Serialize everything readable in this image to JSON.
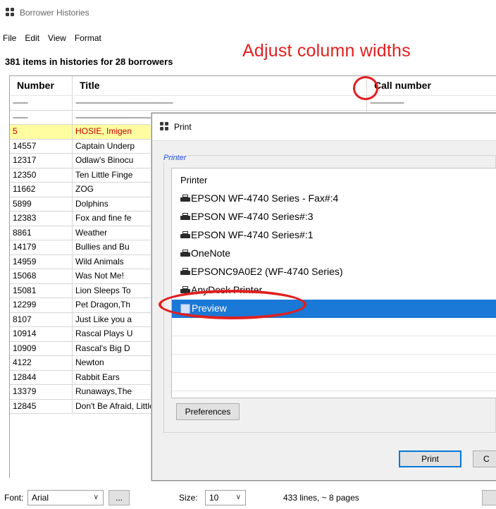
{
  "window": {
    "title": "Borrower Histories"
  },
  "menu": [
    "File",
    "Edit",
    "View",
    "Format"
  ],
  "summary": "381 items in histories for 28 borrowers",
  "annotation": "Adjust column widths",
  "table": {
    "headers": {
      "number": "Number",
      "title": "Title",
      "call": "Call number"
    },
    "rows": [
      {
        "number": "-------",
        "title": "----------------------------------------------",
        "call": "----------------",
        "type": "dash"
      },
      {
        "number": "-------",
        "title": "----------------------------------------------",
        "call": "",
        "type": "dash"
      },
      {
        "number": "5",
        "title": "HOSIE, Imigen",
        "call": "",
        "type": "highlight"
      },
      {
        "number": "14557",
        "title": "Captain Underp",
        "call": ""
      },
      {
        "number": "12317",
        "title": "Odlaw's Binocu",
        "call": ""
      },
      {
        "number": "12350",
        "title": "Ten Little Finge",
        "call": ""
      },
      {
        "number": "11662",
        "title": "ZOG",
        "call": ""
      },
      {
        "number": "5899",
        "title": "Dolphins",
        "call": ""
      },
      {
        "number": "12383",
        "title": "Fox and fine fe",
        "call": ""
      },
      {
        "number": "8861",
        "title": "Weather",
        "call": ""
      },
      {
        "number": "14179",
        "title": "Bullies and Bu",
        "call": ""
      },
      {
        "number": "14959",
        "title": "Wild Animals",
        "call": ""
      },
      {
        "number": "15068",
        "title": "Was Not Me!",
        "call": ""
      },
      {
        "number": "15081",
        "title": "Lion Sleeps To",
        "call": ""
      },
      {
        "number": "12299",
        "title": "Pet Dragon,Th",
        "call": ""
      },
      {
        "number": "8107",
        "title": "Just Like you a",
        "call": ""
      },
      {
        "number": "10914",
        "title": "Rascal Plays U",
        "call": ""
      },
      {
        "number": "10909",
        "title": "Rascal's Big D",
        "call": ""
      },
      {
        "number": "4122",
        "title": "Newton",
        "call": ""
      },
      {
        "number": "12844",
        "title": "Rabbit Ears",
        "call": ""
      },
      {
        "number": "13379",
        "title": "Runaways,The",
        "call": ""
      },
      {
        "number": "12845",
        "title": "Don't Be Afraid, Little One",
        "call": ""
      }
    ]
  },
  "dialog": {
    "title": "Print",
    "group_label": "Printer",
    "list_header": "Printer",
    "printers": [
      {
        "name": "EPSON WF-4740 Series - Fax#:4",
        "icon": "printer-icon"
      },
      {
        "name": "EPSON WF-4740 Series#:3",
        "icon": "printer-icon"
      },
      {
        "name": "EPSON WF-4740 Series#:1",
        "icon": "printer-icon"
      },
      {
        "name": "OneNote",
        "icon": "printer-icon"
      },
      {
        "name": "EPSONC9A0E2 (WF-4740 Series)",
        "icon": "printer-icon"
      },
      {
        "name": "AnyDesk Printer",
        "icon": "printer-icon"
      },
      {
        "name": "Preview",
        "icon": "preview-icon",
        "selected": true
      }
    ],
    "preferences_label": "Preferences",
    "print_label": "Print",
    "cancel_label": "C"
  },
  "status": {
    "font_label": "Font:",
    "font_value": "Arial",
    "more_label": "...",
    "size_label": "Size:",
    "size_value": "10",
    "info": "433 lines, ~ 8 pages"
  },
  "colors": {
    "annotation": "#e02020",
    "selection": "#1a78d6",
    "highlight_row_bg": "#fffda0",
    "highlight_row_text": "#c00000"
  }
}
